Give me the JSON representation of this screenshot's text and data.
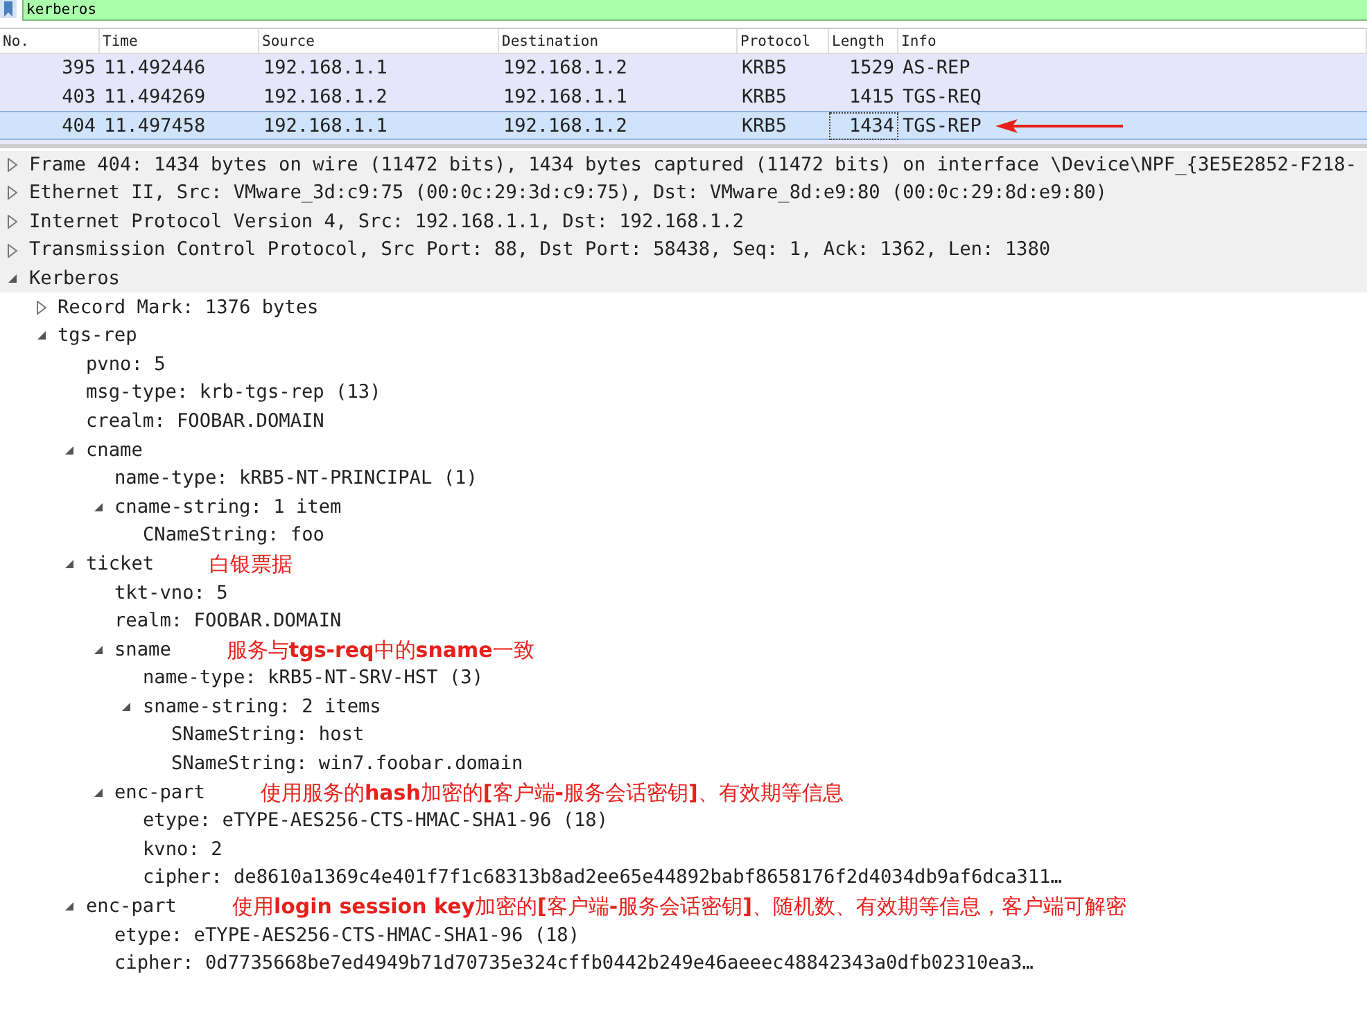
{
  "filter": {
    "value": "kerberos"
  },
  "packet_list": {
    "columns": [
      "No.",
      "Time",
      "Source",
      "Destination",
      "Protocol",
      "Length",
      "Info"
    ],
    "rows": [
      {
        "cells": [
          "395",
          "11.492446",
          "192.168.1.1",
          "192.168.1.2",
          "KRB5",
          "1529",
          "AS-REP"
        ],
        "selected": false
      },
      {
        "cells": [
          "403",
          "11.494269",
          "192.168.1.2",
          "192.168.1.1",
          "KRB5",
          "1415",
          "TGS-REQ"
        ],
        "selected": false
      },
      {
        "cells": [
          "404",
          "11.497458",
          "192.168.1.1",
          "192.168.1.2",
          "KRB5",
          "1434",
          "TGS-REP"
        ],
        "selected": true
      }
    ]
  },
  "details": [
    {
      "label": "Frame 404: 1434 bytes on wire (11472 bits), 1434 bytes captured (11472 bits) on interface \\Device\\NPF_{3E5E2852-F218-",
      "expanded": false
    },
    {
      "label": "Ethernet II, Src: VMware_3d:c9:75 (00:0c:29:3d:c9:75), Dst: VMware_8d:e9:80 (00:0c:29:8d:e9:80)",
      "expanded": false
    },
    {
      "label": "Internet Protocol Version 4, Src: 192.168.1.1, Dst: 192.168.1.2",
      "expanded": false
    },
    {
      "label": "Transmission Control Protocol, Src Port: 88, Dst Port: 58438, Seq: 1, Ack: 1362, Len: 1380",
      "expanded": false
    },
    {
      "label": "Kerberos",
      "expanded": true,
      "children": [
        {
          "label": "Record Mark: 1376 bytes",
          "expanded": false
        },
        {
          "label": "tgs-rep",
          "expanded": true,
          "children": [
            {
              "label": "pvno: 5"
            },
            {
              "label": "msg-type: krb-tgs-rep (13)"
            },
            {
              "label": "crealm: FOOBAR.DOMAIN"
            },
            {
              "label": "cname",
              "expanded": true,
              "children": [
                {
                  "label": "name-type: kRB5-NT-PRINCIPAL (1)"
                },
                {
                  "label": "cname-string: 1 item",
                  "expanded": true,
                  "children": [
                    {
                      "label": "CNameString: foo"
                    }
                  ]
                }
              ]
            },
            {
              "label": "ticket",
              "expanded": true,
              "annotation": "白银票据",
              "children": [
                {
                  "label": "tkt-vno: 5"
                },
                {
                  "label": "realm: FOOBAR.DOMAIN"
                },
                {
                  "label": "sname",
                  "expanded": true,
                  "annotation": "服务与**tgs-req**中的**sname**一致",
                  "children": [
                    {
                      "label": "name-type: kRB5-NT-SRV-HST (3)"
                    },
                    {
                      "label": "sname-string: 2 items",
                      "expanded": true,
                      "children": [
                        {
                          "label": "SNameString: host"
                        },
                        {
                          "label": "SNameString: win7.foobar.domain"
                        }
                      ]
                    }
                  ]
                },
                {
                  "label": "enc-part",
                  "expanded": true,
                  "annotation": "使用服务的**hash**加密的**[**客户端**-**服务会话密钥**]**、有效期等信息",
                  "children": [
                    {
                      "label": "etype: eTYPE-AES256-CTS-HMAC-SHA1-96 (18)"
                    },
                    {
                      "label": "kvno: 2"
                    },
                    {
                      "label": "cipher: de8610a1369c4e401f7f1c68313b8ad2ee65e44892babf8658176f2d4034db9af6dca311…"
                    }
                  ]
                }
              ]
            },
            {
              "label": "enc-part",
              "expanded": true,
              "annotation": "使用**login session key**加密的**[**客户端**-**服务会话密钥**]**、随机数、有效期等信息，客户端可解密",
              "children": [
                {
                  "label": "etype: eTYPE-AES256-CTS-HMAC-SHA1-96 (18)"
                },
                {
                  "label": "cipher: 0d7735668be7ed4949b71d70735e324cffb0442b249e46aeeec48842343a0dfb02310ea3…"
                }
              ]
            }
          ]
        }
      ]
    }
  ]
}
